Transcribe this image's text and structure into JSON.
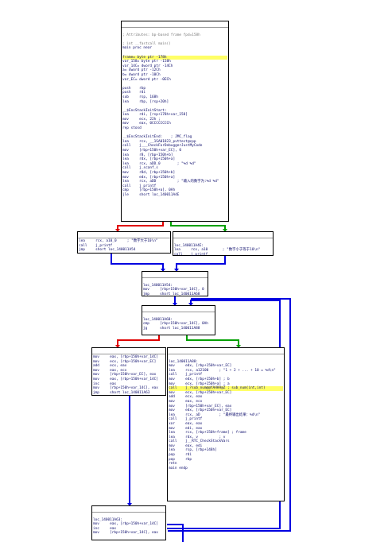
{
  "graph": {
    "main_block": {
      "lines": [
        "",
        "; Attributes: bp-based frame fpd=158h",
        "",
        "; int __fastcall main()",
        "main proc near",
        "",
        "frame= byte ptr -178h",
        "var_158= byte ptr -158h",
        "var_14C= dword ptr -14Ch",
        "a= dword ptr -12Ch",
        "b= dword ptr -10Ch",
        "var_EC= dword ptr -0ECh",
        "",
        "push    rbp",
        "push    rdi",
        "sub     rsp, 168h",
        "lea     rbp, [rsp+20h]",
        "",
        "__$EncStackInitStart:",
        "lea     rdi, [rsp+178h+var_158]",
        "mov     ecx, 22h ;",
        "mov     eax, 0CCCCCCCCh",
        "rep stosd",
        "",
        "__$EncStackInitEnd:    ; JMC_flag",
        "lea     rcx, __1SA01823_pvttest@cpp",
        "call    j___CheckForDebuggerJustMyCode",
        "mov     [rbp+150h+var_EC], 0",
        "lea     r8, [rbp+150h+b]",
        "lea     rdx, [rbp+150h+a]",
        "lea     rcx, aDD_0        ; \"%d %d\"",
        "call    j_scanf_s",
        "mov     r8d, [rbp+150h+b]",
        "mov     edx, [rbp+150h+a]",
        "lea     rcx, aDD          ; \"输入的数字为:%d %d\"",
        "call    j_printf",
        "cmp     [rbp+150h+a], 0Ah",
        "jle     short loc_140011A4E"
      ]
    },
    "left_branch": {
      "lines": [
        "lea     rcx, a10_0     ; \"数字大于10\\n\"",
        "call    j_printf",
        "jmp     short loc_140011A54"
      ]
    },
    "right_branch": {
      "lines": [
        "",
        "loc_140011A4E:",
        "lea     rcx, a10       ; \"数字小于等于10\\n\"",
        "call    j_printf"
      ]
    },
    "merge_block": {
      "lines": [
        "",
        "loc_140011A54:",
        "mov     [rbp+150h+var_14C], 0",
        "jmp     short loc_140011A68"
      ]
    },
    "loop_cond": {
      "lines": [
        "",
        "loc_140011A68:",
        "cmp     [rbp+150h+var_14C], 0Ah",
        "jg      short loc_140011A88"
      ]
    },
    "loop_body": {
      "lines": [
        "mov     eax, [rbp+150h+var_14C]",
        "mov     ecx, [rbp+150h+var_EC]",
        "add     ecx, eax",
        "mov     eax, ecx",
        "mov     [rbp+150h+var_EC], eax",
        "mov     eax, [rbp+150h+var_14C]",
        "inc     eax",
        "mov     [rbp+150h+var_14C], eax",
        "jmp     short loc_140011A63"
      ]
    },
    "exit_block": {
      "lines": [
        "",
        "loc_140011A88:",
        "mov     edx, [rbp+150h+var_EC]",
        "lea     rcx, a12100     ; \"1 + 2 + ... + 10 = %d\\n\"",
        "call    j_printf",
        "mov     edx, [rbp+150h+b] ; b",
        "mov     ecx, [rbp+150h+a] ; a",
        "call    j_?sub_num@@YAHHH@Z ; sub_num(int,int)",
        "mov     ecx, [rbp+150h+var_EC]",
        "add     ecx, eax",
        "mov     eax, ecx",
        "mov     [rbp+150h+var_EC], eax",
        "mov     edx, [rbp+150h+var_EC]",
        "lea     rcx, aD         ; \"最终输出结果：%d\\n\"",
        "call    j_printf",
        "xor     eax, eax",
        "mov     edi, eax",
        "lea     rcx, [rbp+150h+frame] ; frame",
        "lea     rdx, v          ; v",
        "call    j__RTC_CheckStackVars",
        "mov     eax, edi",
        "lea     rsp, [rbp+148h]",
        "pop     rdi",
        "pop     rbp",
        "retn",
        "main endp"
      ]
    },
    "loop_inc": {
      "lines": [
        "",
        "loc_140011A63:",
        "mov     eax, [rbp+150h+var_14C]",
        "inc     eax",
        "mov     [rbp+150h+var_14C], eax"
      ]
    },
    "edge_colors": {
      "true_branch": "#00a000",
      "false_branch": "#e00000",
      "unconditional": "#0000e0"
    },
    "highlight_color": "#ffff66"
  }
}
